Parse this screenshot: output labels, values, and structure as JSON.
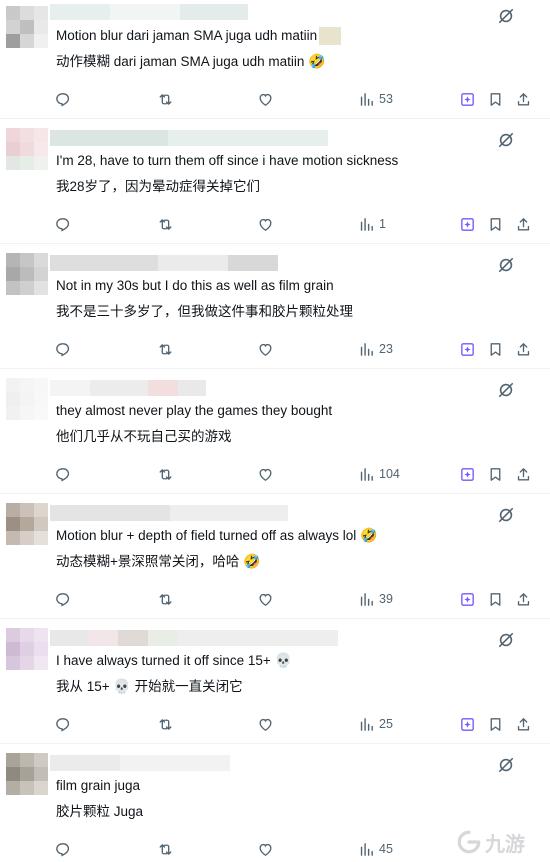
{
  "colors": {
    "grok_blue": "#7856ff",
    "icon_gray": "#536471",
    "divider": "#eff3f4"
  },
  "replies": [
    {
      "text_en": "Motion blur dari jaman SMA juga udh matiin",
      "text_zh": "动作模糊 dari jaman SMA juga udh matiin",
      "emoji_zh": "🤣",
      "views": "53",
      "show_bookmark_extra": true
    },
    {
      "text_en": "I'm 28, have to turn them off since i have motion sickness",
      "text_zh": "我28岁了，因为晕动症得关掉它们",
      "views": "1",
      "show_bookmark_extra": true
    },
    {
      "text_en": "Not in my 30s but I do this as well as film grain",
      "text_zh": "我不是三十多岁了，但我做这件事和胶片颗粒处理",
      "views": "23",
      "show_bookmark_extra": true
    },
    {
      "text_en": "they almost never play the games they bought",
      "text_zh": "他们几乎从不玩自己买的游戏",
      "views": "104",
      "show_bookmark_extra": true
    },
    {
      "text_en": "Motion blur + depth of field turned off as always lol",
      "emoji_en": "🤣",
      "text_zh": "动态模糊+景深照常关闭，哈哈",
      "emoji_zh": "🤣",
      "views": "39",
      "show_bookmark_extra": true
    },
    {
      "text_en": "I have always turned it off since 15+",
      "emoji_en": "💀",
      "text_zh_a": "我从 15+",
      "emoji_zh": "💀",
      "text_zh_b": "开始就一直关闭它",
      "views": "25",
      "show_bookmark_extra": true
    },
    {
      "text_en": "film grain juga",
      "text_zh": "胶片颗粒 Juga",
      "views": "45",
      "show_bookmark_extra": false
    }
  ],
  "watermark": {
    "text": "九游"
  }
}
